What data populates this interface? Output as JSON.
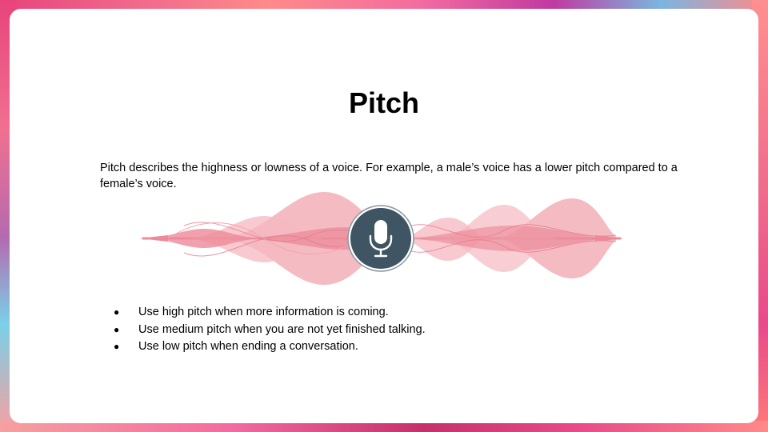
{
  "slide": {
    "title": "Pitch",
    "intro": "Pitch describes the highness or lowness of a voice. For example, a male’s voice has a lower pitch compared to a female’s voice.",
    "bullets": [
      "Use high pitch when more information is coming.",
      "Use medium pitch when you are not yet finished talking.",
      "Use low pitch when ending a conversation."
    ],
    "bullet_glyph": "●"
  },
  "graphic": {
    "icon": "microphone-icon",
    "wave_color": "#ee8a98",
    "wave_light_color": "#f5b8c0",
    "mic_circle_color": "#3f5563",
    "mic_ring_color": "#8a98a2"
  }
}
